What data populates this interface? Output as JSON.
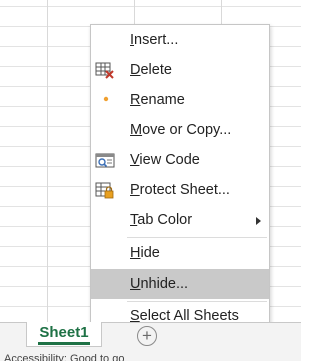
{
  "menu": {
    "items": [
      {
        "id": "insert",
        "pre": "",
        "ul": "I",
        "post": "nsert..."
      },
      {
        "id": "delete",
        "pre": "",
        "ul": "D",
        "post": "elete",
        "icon": "delete-sheet-icon"
      },
      {
        "id": "rename",
        "pre": "",
        "ul": "R",
        "post": "ename",
        "icon": "rename-dot-icon"
      },
      {
        "id": "move-copy",
        "pre": "",
        "ul": "M",
        "post": "ove or Copy..."
      },
      {
        "id": "view-code",
        "pre": "",
        "ul": "V",
        "post": "iew Code",
        "icon": "view-code-icon"
      },
      {
        "id": "protect-sheet",
        "pre": "",
        "ul": "P",
        "post": "rotect Sheet...",
        "icon": "protect-sheet-icon"
      },
      {
        "id": "tab-color",
        "pre": "",
        "ul": "T",
        "post": "ab Color",
        "submenu_icon": "chevron-right-icon"
      },
      {
        "id": "hide",
        "pre": "",
        "ul": "H",
        "post": "ide"
      },
      {
        "id": "unhide",
        "pre": "",
        "ul": "U",
        "post": "nhide...",
        "highlighted": true
      },
      {
        "id": "select-all-sheets",
        "pre": "",
        "ul": "S",
        "post": "elect All Sheets"
      }
    ]
  },
  "tabs": {
    "active_sheet": "Sheet1",
    "add_icon": "plus-circle-icon",
    "add_symbol": "+"
  },
  "status": {
    "text": "Accessibility: Good to go"
  },
  "colors": {
    "sheet_tab_green": "#1e7145",
    "highlight": "#c9c9c9",
    "delete_red": "#c0392b",
    "rename_orange": "#f0a030"
  }
}
